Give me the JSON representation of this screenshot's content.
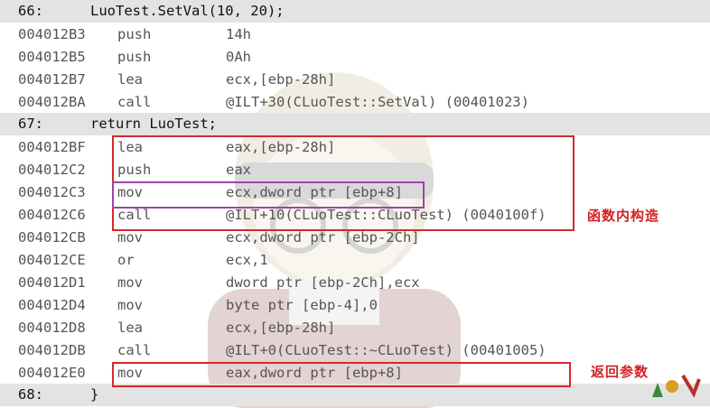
{
  "source_lines": [
    {
      "line": "66:",
      "code": "LuoTest.SetVal(10, 20);"
    },
    {
      "line": "67:",
      "code": "return LuoTest;"
    },
    {
      "line": "68:",
      "code": "}"
    }
  ],
  "block1": [
    {
      "addr": "004012B3",
      "mn": "push",
      "op": "14h"
    },
    {
      "addr": "004012B5",
      "mn": "push",
      "op": "0Ah"
    },
    {
      "addr": "004012B7",
      "mn": "lea",
      "op": "ecx,[ebp-28h]"
    },
    {
      "addr": "004012BA",
      "mn": "call",
      "op": "@ILT+30(CLuoTest::SetVal) (00401023)"
    }
  ],
  "block2": [
    {
      "addr": "004012BF",
      "mn": "lea",
      "op": "eax,[ebp-28h]"
    },
    {
      "addr": "004012C2",
      "mn": "push",
      "op": "eax"
    },
    {
      "addr": "004012C3",
      "mn": "mov",
      "op": "ecx,dword ptr [ebp+8]"
    },
    {
      "addr": "004012C6",
      "mn": "call",
      "op": "@ILT+10(CLuoTest::CLuoTest) (0040100f)"
    },
    {
      "addr": "004012CB",
      "mn": "mov",
      "op": "ecx,dword ptr [ebp-2Ch]"
    },
    {
      "addr": "004012CE",
      "mn": "or",
      "op": "ecx,1"
    },
    {
      "addr": "004012D1",
      "mn": "mov",
      "op": "dword ptr [ebp-2Ch],ecx"
    },
    {
      "addr": "004012D4",
      "mn": "mov",
      "op": "byte ptr [ebp-4],0"
    },
    {
      "addr": "004012D8",
      "mn": "lea",
      "op": "ecx,[ebp-28h]"
    },
    {
      "addr": "004012DB",
      "mn": "call",
      "op": "@ILT+0(CLuoTest::~CLuoTest) (00401005)"
    },
    {
      "addr": "004012E0",
      "mn": "mov",
      "op": "eax,dword ptr [ebp+8]"
    }
  ],
  "annotations": {
    "copy_constructor": "函数内构造",
    "return_param": "返回参数"
  },
  "colors": {
    "source_row_bg": "#e3e3e3",
    "highlight_red": "#d42a2a",
    "highlight_purple": "#9b45a8",
    "annotation_text": "#d42020"
  }
}
